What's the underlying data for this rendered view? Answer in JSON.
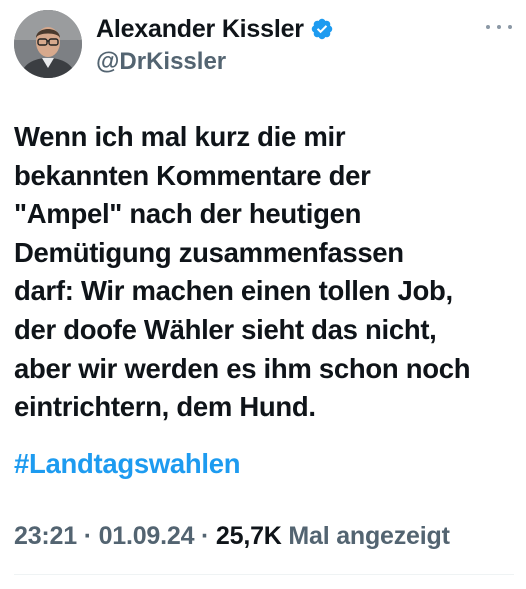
{
  "author": {
    "display_name": "Alexander Kissler",
    "handle": "@DrKissler",
    "verified_icon": "verified-badge-icon",
    "avatar_icon": "profile-photo"
  },
  "tweet": {
    "text": "Wenn ich mal kurz die mir\nbekannten Kommentare der\n\"Ampel\" nach der heutigen\nDemütigung zusammenfassen\ndarf: Wir machen einen tollen Job,\nder doofe Wähler sieht das nicht,\naber wir werden es ihm schon noch\neintrichtern, dem Hund.",
    "hashtag": "#Landtagswahlen"
  },
  "meta": {
    "time": "23:21",
    "sep1": " · ",
    "date": "01.09.24",
    "sep2": " · ",
    "views_count": "25,7K",
    "views_label": " Mal angezeigt"
  },
  "colors": {
    "text": "#0f1419",
    "secondary": "#536471",
    "link": "#1d9bf0",
    "verified": "#1d9bf0"
  }
}
